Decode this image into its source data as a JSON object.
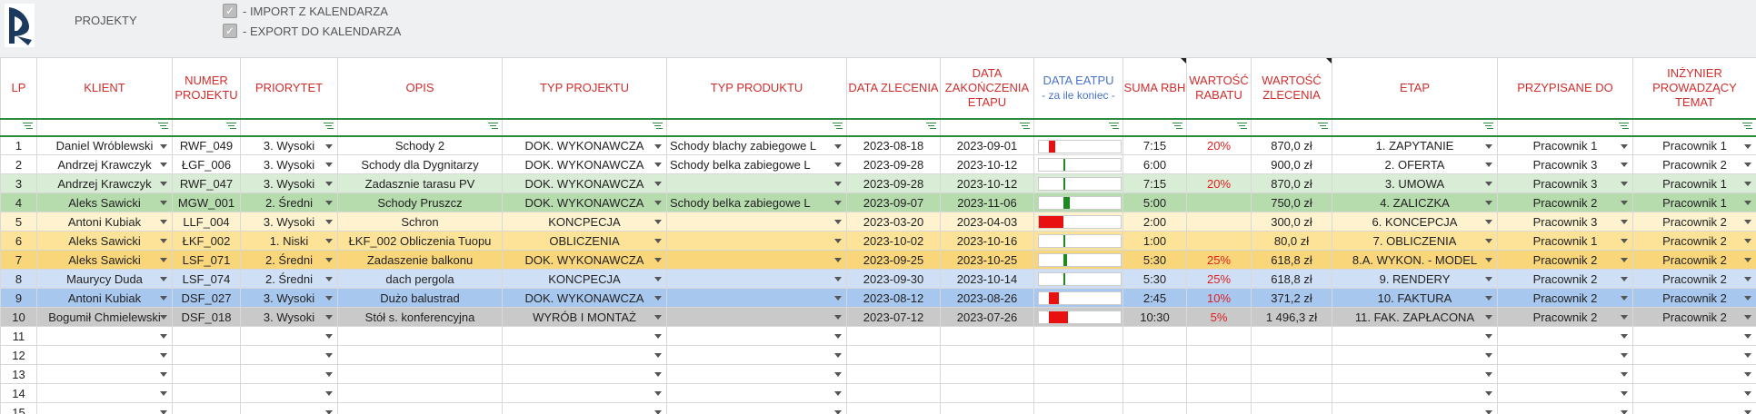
{
  "header": {
    "title": "PROJEKTY",
    "checkboxes": [
      {
        "label": "- IMPORT Z KALENDARZA",
        "checked": true
      },
      {
        "label": "- EXPORT DO KALENDARZA",
        "checked": true
      }
    ]
  },
  "columns": [
    {
      "label": "LP"
    },
    {
      "label": "KLIENT"
    },
    {
      "label": "NUMER PROJEKTU"
    },
    {
      "label": "PRIORYTET"
    },
    {
      "label": "OPIS"
    },
    {
      "label": "TYP PROJEKTU"
    },
    {
      "label": "TYP PRODUKTU"
    },
    {
      "label": "DATA ZLECENIA"
    },
    {
      "label": "DATA ZAKOŃCZENIA ETAPU"
    },
    {
      "label": "DATA EATPU",
      "sub": "- za ile koniec -"
    },
    {
      "label": "SUMA RBH"
    },
    {
      "label": "WARTOŚĆ RABATU"
    },
    {
      "label": "WARTOŚĆ ZLECENIA"
    },
    {
      "label": "ETAP"
    },
    {
      "label": "PRZYPISANE DO"
    },
    {
      "label": "INŻYNIER PROWADZĄCY TEMAT"
    }
  ],
  "colors": {
    "header_text": "#d12d2d",
    "header_blue": "#4a73c9",
    "percent": "#e02020",
    "bar_red": "#e81010",
    "bar_green": "#1c8a1c"
  },
  "rows": [
    {
      "lp": "1",
      "klient": "Daniel Wróblewski",
      "numer": "RWF_049",
      "priorytet": "3. Wysoki",
      "opis": "Schody 2",
      "typ_projektu": "DOK. WYKONAWCZA",
      "typ_produktu": "Schody blachy zabiegowe L",
      "data_zlecenia": "2023-08-18",
      "data_zakonczenia": "2023-09-01",
      "bar": {
        "color": "red",
        "fraction": 0.08
      },
      "rbh": "7:15",
      "rabat": "20%",
      "wartosc": "870,0 zł",
      "etap": "1. ZAPYTANIE",
      "przypisane": "Pracownik 1",
      "inzynier": "Pracownik 1",
      "style": "white"
    },
    {
      "lp": "2",
      "klient": "Andrzej Krawczyk",
      "numer": "ŁGF_006",
      "priorytet": "3. Wysoki",
      "opis": "Schody dla Dygnitarzy",
      "typ_projektu": "DOK. WYKONAWCZA",
      "typ_produktu": "Schody belka zabiegowe L",
      "data_zlecenia": "2023-09-28",
      "data_zakonczenia": "2023-10-12",
      "bar": {
        "color": "green",
        "fraction": 0.02
      },
      "rbh": "6:00",
      "rabat": "",
      "wartosc": "900,0 zł",
      "etap": "2. OFERTA",
      "przypisane": "Pracownik 3",
      "inzynier": "Pracownik 2",
      "style": "white"
    },
    {
      "lp": "3",
      "klient": "Andrzej Krawczyk",
      "numer": "RWF_047",
      "priorytet": "3. Wysoki",
      "opis": "Zadasznie tarasu PV",
      "typ_projektu": "DOK. WYKONAWCZA",
      "typ_produktu": "",
      "data_zlecenia": "2023-09-28",
      "data_zakonczenia": "2023-10-12",
      "bar": {
        "color": "green",
        "fraction": 0.02
      },
      "rbh": "7:15",
      "rabat": "20%",
      "wartosc": "870,0 zł",
      "etap": "3. UMOWA",
      "przypisane": "Pracownik 3",
      "inzynier": "Pracownik 1",
      "style": "g1"
    },
    {
      "lp": "4",
      "klient": "Aleks Sawicki",
      "numer": "MGW_001",
      "priorytet": "2. Średni",
      "opis": "Schody Pruszcz",
      "typ_projektu": "DOK. WYKONAWCZA",
      "typ_produktu": "Schody belka zabiegowe L",
      "data_zlecenia": "2023-09-07",
      "data_zakonczenia": "2023-11-06",
      "bar": {
        "color": "green",
        "fraction": 0.08
      },
      "rbh": "5:00",
      "rabat": "",
      "wartosc": "750,0 zł",
      "etap": "4. ZALICZKA",
      "przypisane": "Pracownik 2",
      "inzynier": "Pracownik 1",
      "style": "g2"
    },
    {
      "lp": "5",
      "klient": "Antoni Kubiak",
      "numer": "LLF_004",
      "priorytet": "3. Wysoki",
      "opis": "Schron",
      "typ_projektu": "KONCPECJA",
      "typ_produktu": "",
      "data_zlecenia": "2023-03-20",
      "data_zakonczenia": "2023-04-03",
      "bar": {
        "color": "red",
        "fraction": 0.3
      },
      "rbh": "2:00",
      "rabat": "",
      "wartosc": "300,0 zł",
      "etap": "6. KONCEPCJA",
      "przypisane": "Pracownik 3",
      "inzynier": "Pracownik 2",
      "style": "y1"
    },
    {
      "lp": "6",
      "klient": "Aleks Sawicki",
      "numer": "ŁKF_002",
      "priorytet": "1. Niski",
      "opis": "ŁKF_002 Obliczenia Tuopu",
      "typ_projektu": "OBLICZENIA",
      "typ_produktu": "",
      "data_zlecenia": "2023-10-02",
      "data_zakonczenia": "2023-10-16",
      "bar": {
        "color": "green",
        "fraction": 0.02
      },
      "rbh": "1:00",
      "rabat": "",
      "wartosc": "80,0 zł",
      "etap": "7. OBLICZENIA",
      "przypisane": "Pracownik 1",
      "inzynier": "Pracownik 2",
      "style": "y2"
    },
    {
      "lp": "7",
      "klient": "Aleks Sawicki",
      "numer": "LSF_071",
      "priorytet": "2. Średni",
      "opis": "Zadaszenie balkonu",
      "typ_projektu": "DOK. WYKONAWCZA",
      "typ_produktu": "",
      "data_zlecenia": "2023-09-25",
      "data_zakonczenia": "2023-10-25",
      "bar": {
        "color": "green",
        "fraction": 0.04
      },
      "rbh": "5:30",
      "rabat": "25%",
      "wartosc": "618,8 zł",
      "etap": "8.A. WYKON. - MODEL",
      "przypisane": "Pracownik 2",
      "inzynier": "Pracownik 2",
      "style": "o"
    },
    {
      "lp": "8",
      "klient": "Maurycy Duda",
      "numer": "LSF_074",
      "priorytet": "2. Średni",
      "opis": "dach pergola",
      "typ_projektu": "KONCPECJA",
      "typ_produktu": "",
      "data_zlecenia": "2023-09-30",
      "data_zakonczenia": "2023-10-14",
      "bar": {
        "color": "green",
        "fraction": 0.02
      },
      "rbh": "5:30",
      "rabat": "25%",
      "wartosc": "618,8 zł",
      "etap": "9. RENDERY",
      "przypisane": "Pracownik 2",
      "inzynier": "Pracownik 2",
      "style": "b1"
    },
    {
      "lp": "9",
      "klient": "Antoni Kubiak",
      "numer": "DSF_027",
      "priorytet": "3. Wysoki",
      "opis": "Dużo balustrad",
      "typ_projektu": "DOK. WYKONAWCZA",
      "typ_produktu": "",
      "data_zlecenia": "2023-08-12",
      "data_zakonczenia": "2023-08-26",
      "bar": {
        "color": "red",
        "fraction": 0.12
      },
      "rbh": "2:45",
      "rabat": "10%",
      "wartosc": "371,2 zł",
      "etap": "10. FAKTURA",
      "przypisane": "Pracownik 2",
      "inzynier": "Pracownik 2",
      "style": "b2"
    },
    {
      "lp": "10",
      "klient": "Bogumił Chmielewski",
      "numer": "DSF_018",
      "priorytet": "3. Wysoki",
      "opis": "Stół s. konferencyjna",
      "typ_projektu": "WYRÓB I MONTAŻ",
      "typ_produktu": "",
      "data_zlecenia": "2023-07-12",
      "data_zakonczenia": "2023-07-26",
      "bar": {
        "color": "red",
        "fraction": 0.24
      },
      "rbh": "10:30",
      "rabat": "5%",
      "wartosc": "1 496,3 zł",
      "etap": "11. FAK. ZAPŁACONA",
      "przypisane": "Pracownik 2",
      "inzynier": "Pracownik 2",
      "style": "gr"
    }
  ],
  "empty_rows": [
    "11",
    "12",
    "13",
    "14",
    "15"
  ]
}
